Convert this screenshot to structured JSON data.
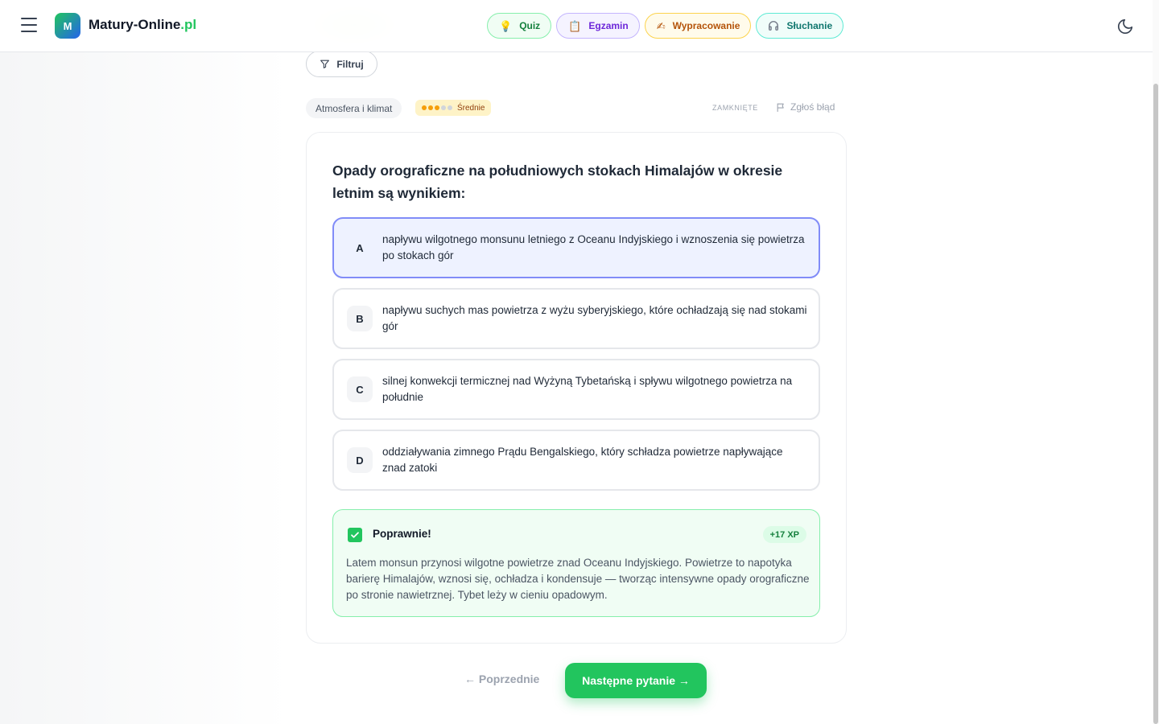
{
  "brand": {
    "logo_letter": "M",
    "name": "Matury-Online",
    "tld": ".pl"
  },
  "nav": {
    "pills": [
      {
        "label": "Quiz",
        "icon": "lightbulb-icon"
      },
      {
        "label": "Egzamin",
        "icon": "clipboard-icon"
      },
      {
        "label": "Wypracowanie",
        "icon": "writing-hand-icon"
      },
      {
        "label": "Słuchanie",
        "icon": "headphones-icon"
      }
    ]
  },
  "filter": {
    "label": "Filtruj"
  },
  "meta": {
    "topic": "Atmosfera i klimat",
    "level_label": "Średnie",
    "level_value": 3,
    "level_max": 5,
    "closed_label": "ZAMKNIĘTE",
    "report_label": "Zgłoś błąd"
  },
  "question": {
    "text": "Opady orograficzne na południowych stokach Himalajów w okresie letnim są wynikiem:",
    "selected": "A",
    "options": [
      {
        "letter": "A",
        "text": "napływu wilgotnego monsunu letniego z Oceanu Indyjskiego i wznoszenia się powietrza po stokach gór"
      },
      {
        "letter": "B",
        "text": "napływu suchych mas powietrza z wyżu syberyjskiego, które ochładzają się nad stokami gór"
      },
      {
        "letter": "C",
        "text": "silnej konwekcji termicznej nad Wyżyną Tybetańską i spływu wilgotnego powietrza na południe"
      },
      {
        "letter": "D",
        "text": "oddziaływania zimnego Prądu Bengalskiego, który schładza powietrze napływające znad zatoki"
      }
    ]
  },
  "feedback": {
    "title": "Poprawnie!",
    "xp": "+17 XP",
    "text": "Latem monsun przynosi wilgotne powietrze znad Oceanu Indyjskiego. Powietrze to napotyka barierę Himalajów, wznosi się, ochładza i kondensuje — tworząc intensywne opady orograficzne po stronie nawietrznej. Tybet leży w cieniu opadowym."
  },
  "footer_nav": {
    "prev_label": "← Poprzednie",
    "next_label": "Następne pytanie →"
  },
  "colors": {
    "accent": "#22c55e",
    "selected_border": "#818cf8",
    "selected_bg": "#eef2ff"
  }
}
